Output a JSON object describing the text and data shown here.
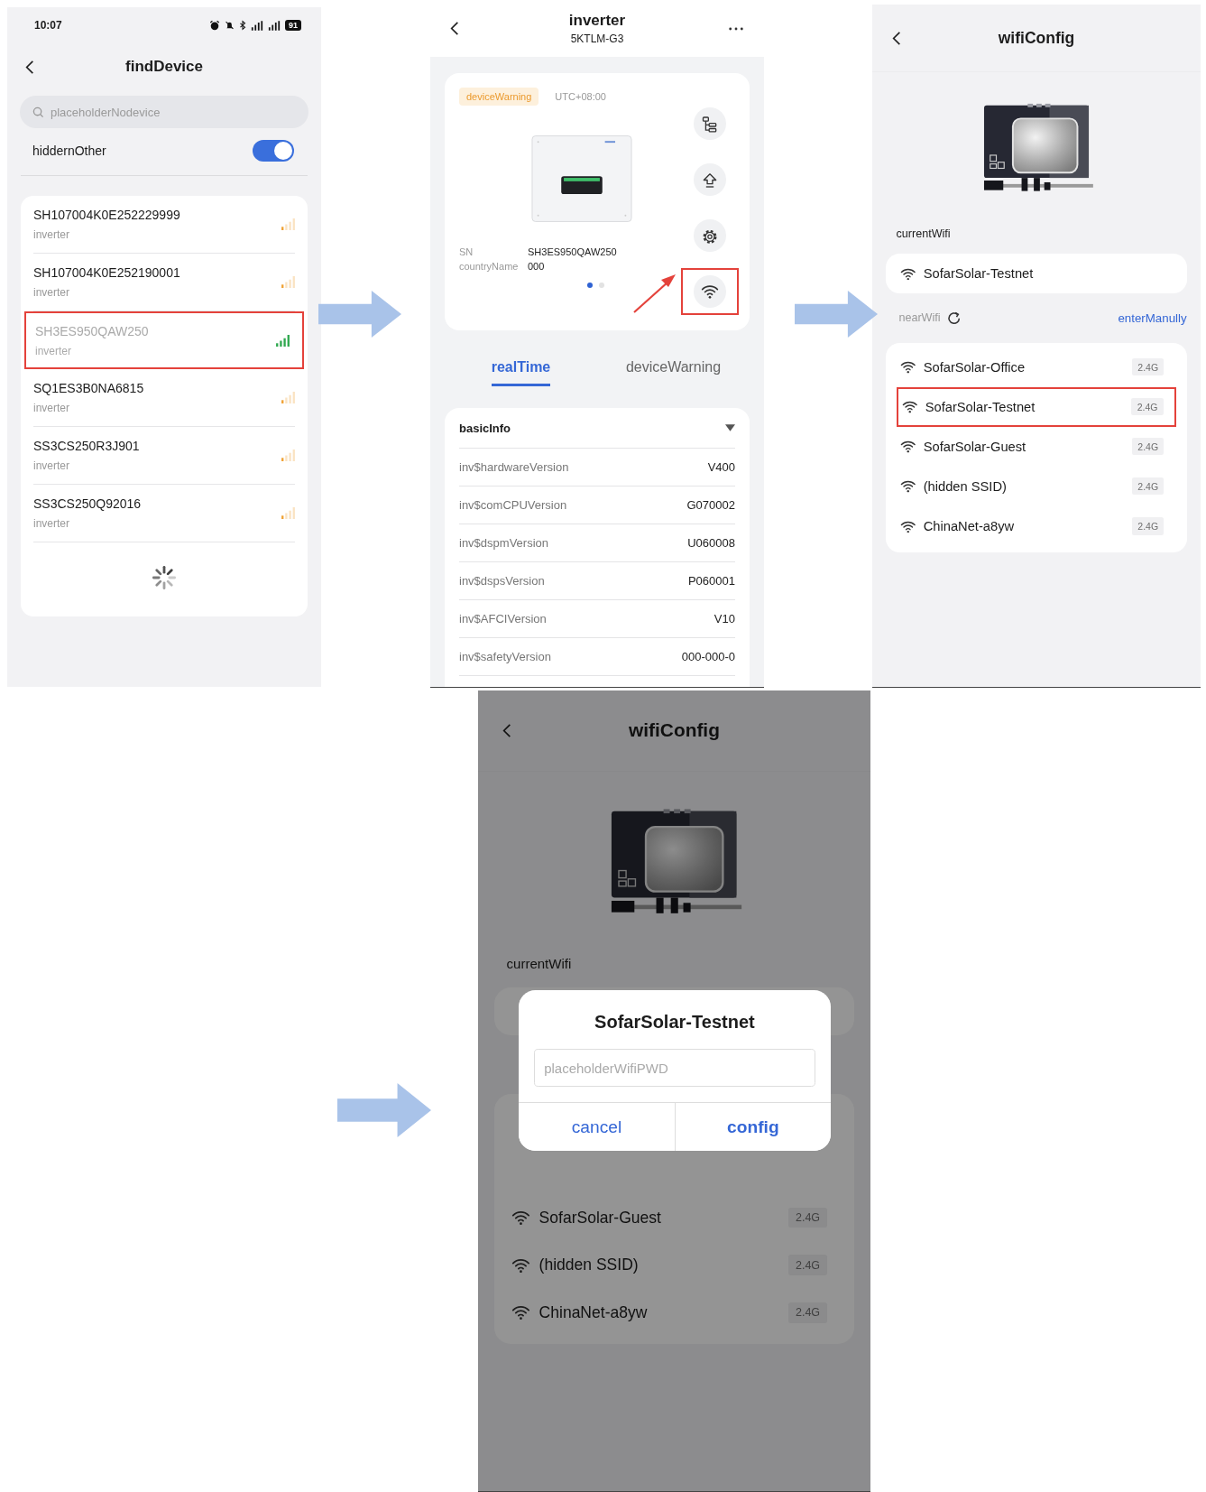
{
  "screens": [
    {
      "kind": "device_list",
      "status_bar": {
        "time": "10:07",
        "battery": "91"
      },
      "title": "findDevice",
      "search": {
        "placeholder": "placeholderNodevice"
      },
      "toggle": {
        "label": "hiddernOther",
        "on": true
      },
      "devices": [
        {
          "name": "SH107004K0E252229999",
          "type": "inverter",
          "color": "#f0a234",
          "selected": false
        },
        {
          "name": "SH107004K0E252190001",
          "type": "inverter",
          "color": "#f0a234",
          "selected": false
        },
        {
          "name": "SH3ES950QAW250",
          "type": "inverter",
          "color": "#2fa84f",
          "selected": true
        },
        {
          "name": "SQ1ES3B0NA6815",
          "type": "inverter",
          "color": "#f0a234",
          "selected": false
        },
        {
          "name": "SS3CS250R3J901",
          "type": "inverter",
          "color": "#f0a234",
          "selected": false
        },
        {
          "name": "SS3CS250Q92016",
          "type": "inverter",
          "color": "#f0a234",
          "selected": false
        }
      ],
      "loading": true
    },
    {
      "kind": "device_detail",
      "title": "inverter",
      "subtitle": "5KTLM-G3",
      "badge": "deviceWarning",
      "timezone": "UTC+08:00",
      "actions": [
        {
          "kind": "tree",
          "highlighted": false
        },
        {
          "kind": "upload",
          "highlighted": false
        },
        {
          "kind": "settings",
          "highlighted": false
        },
        {
          "kind": "wifi",
          "highlighted": true
        }
      ],
      "fields": [
        {
          "label": "SN",
          "value": "SH3ES950QAW250"
        },
        {
          "label": "countryName",
          "value": "000"
        }
      ],
      "pager": [
        {
          "selected": true
        },
        {
          "selected": false
        }
      ],
      "tabs": [
        {
          "label": "realTime",
          "selected": true
        },
        {
          "label": "deviceWarning",
          "selected": false
        }
      ],
      "section": {
        "title": "basicInfo",
        "expanded": true,
        "rows": [
          {
            "label": "inv$hardwareVersion",
            "value": "V400"
          },
          {
            "label": "inv$comCPUVersion",
            "value": "G070002"
          },
          {
            "label": "inv$dspmVersion",
            "value": "U060008"
          },
          {
            "label": "inv$dspsVersion",
            "value": "P060001"
          },
          {
            "label": "inv$AFCIVersion",
            "value": "V10"
          },
          {
            "label": "inv$safetyVersion",
            "value": "000-000-0"
          }
        ]
      }
    },
    {
      "kind": "wifi_config",
      "title": "wifiConfig",
      "current_label": "currentWifi",
      "current_wifi": "SofarSolar-Testnet",
      "near_label": "nearWifi",
      "manual_link": "enterManully",
      "networks": [
        {
          "name": "SofarSolar-Office",
          "band": "2.4G",
          "selected": false
        },
        {
          "name": "SofarSolar-Testnet",
          "band": "2.4G",
          "selected": true
        },
        {
          "name": "SofarSolar-Guest",
          "band": "2.4G",
          "selected": false
        },
        {
          "name": "(hidden SSID)",
          "band": "2.4G",
          "selected": false
        },
        {
          "name": "ChinaNet-a8yw",
          "band": "2.4G",
          "selected": false
        }
      ]
    },
    {
      "kind": "wifi_dialog",
      "title": "wifiConfig",
      "current_label": "currentWifi",
      "networks": [
        {
          "name": "SofarSolar-Guest",
          "band": "2.4G",
          "selected": false
        },
        {
          "name": "(hidden SSID)",
          "band": "2.4G",
          "selected": false
        },
        {
          "name": "ChinaNet-a8yw",
          "band": "2.4G",
          "selected": false
        }
      ],
      "dialog": {
        "title": "SofarSolar-Testnet",
        "placeholder": "placeholderWifiPWD",
        "buttons": [
          {
            "label": "cancel",
            "kind": "cancel"
          },
          {
            "label": "config",
            "kind": "confirm"
          }
        ]
      }
    }
  ]
}
